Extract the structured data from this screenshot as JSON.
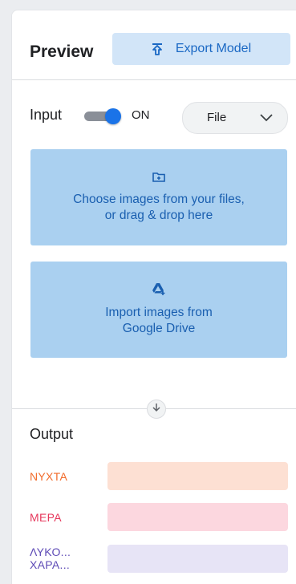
{
  "header": {
    "title": "Preview",
    "export_label": "Export Model",
    "export_icon": "upload-icon"
  },
  "input": {
    "label": "Input",
    "toggle_state": "ON",
    "toggle_on": true,
    "source_selected": "File"
  },
  "upload_cards": [
    {
      "icon": "add-folder-icon",
      "line1": "Choose images from your files,",
      "line2": "or drag & drop here"
    },
    {
      "icon": "google-drive-icon",
      "line1": "Import images from",
      "line2": "Google Drive"
    }
  ],
  "output": {
    "label": "Output",
    "classes": [
      {
        "line1": "ΝΥΧΤΑ",
        "line2": "",
        "color": "#f26c2c",
        "bar_color": "#fde0d3"
      },
      {
        "line1": "ΜΕΡΑ",
        "line2": "",
        "color": "#e6385c",
        "bar_color": "#fcd7df"
      },
      {
        "line1": "ΛΥΚΟ...",
        "line2": "ΧΑΡΑ...",
        "color": "#5e4bb6",
        "bar_color": "#e7e4f6"
      }
    ]
  },
  "colors": {
    "accent": "#1a73e8",
    "card_bg": "#aad0f0",
    "export_bg": "#d2e5f8"
  }
}
